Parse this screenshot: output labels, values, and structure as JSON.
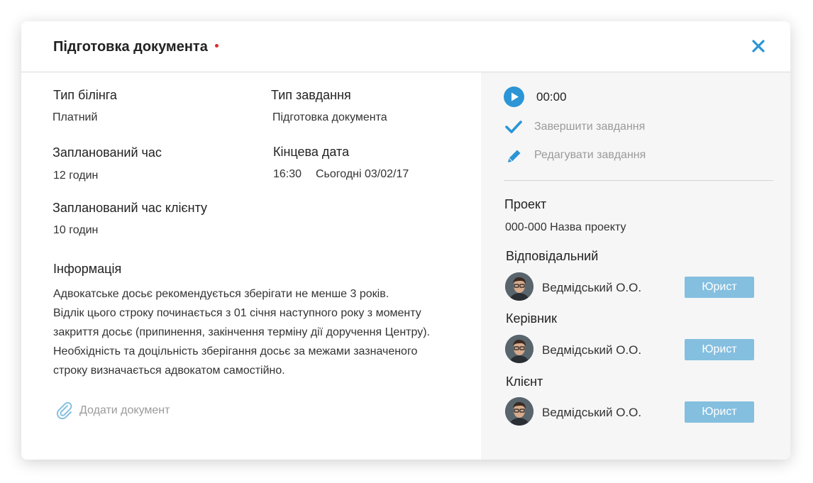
{
  "modal": {
    "title": "Підготовка документа",
    "accent_color": "#2b95d6",
    "required_dot_color": "#e32a2a"
  },
  "details": {
    "billing_type": {
      "label": "Тип білінга",
      "value": "Платний"
    },
    "task_type": {
      "label": "Тип завдання",
      "value": "Підготовка документа"
    },
    "planned_time": {
      "label": "Запланований час",
      "value": "12 годин"
    },
    "deadline": {
      "label": "Кінцева дата",
      "time": "16:30",
      "date": "Сьогодні 03/02/17"
    },
    "client_planned_time": {
      "label": "Запланований час клієнту",
      "value": "10 годин"
    },
    "info": {
      "label": "Інформація",
      "lines": [
        "Адвокатське досьє рекомендується зберігати не менше 3 років.",
        "Відлік цього строку починається з 01 січня наступного року з моменту",
        "закриття досьє (припинення, закінчення терміну дії доручення Центру).",
        "Необхідність та доцільність зберігання досьє за межами зазначеного",
        "строку визначається адвокатом самостійно."
      ]
    },
    "add_document": "Додати документ"
  },
  "actions": {
    "timer": "00:00",
    "complete": "Завершити завдання",
    "edit": "Редагувати завдання"
  },
  "project": {
    "label": "Проект",
    "value": "000-000 Назва проекту"
  },
  "people": [
    {
      "label": "Відповідальний",
      "name": "Ведмідський О.О.",
      "role": "Юрист"
    },
    {
      "label": "Керівник",
      "name": "Ведмідський О.О.",
      "role": "Юрист"
    },
    {
      "label": "Клієнт",
      "name": "Ведмідський О.О.",
      "role": "Юрист"
    }
  ]
}
